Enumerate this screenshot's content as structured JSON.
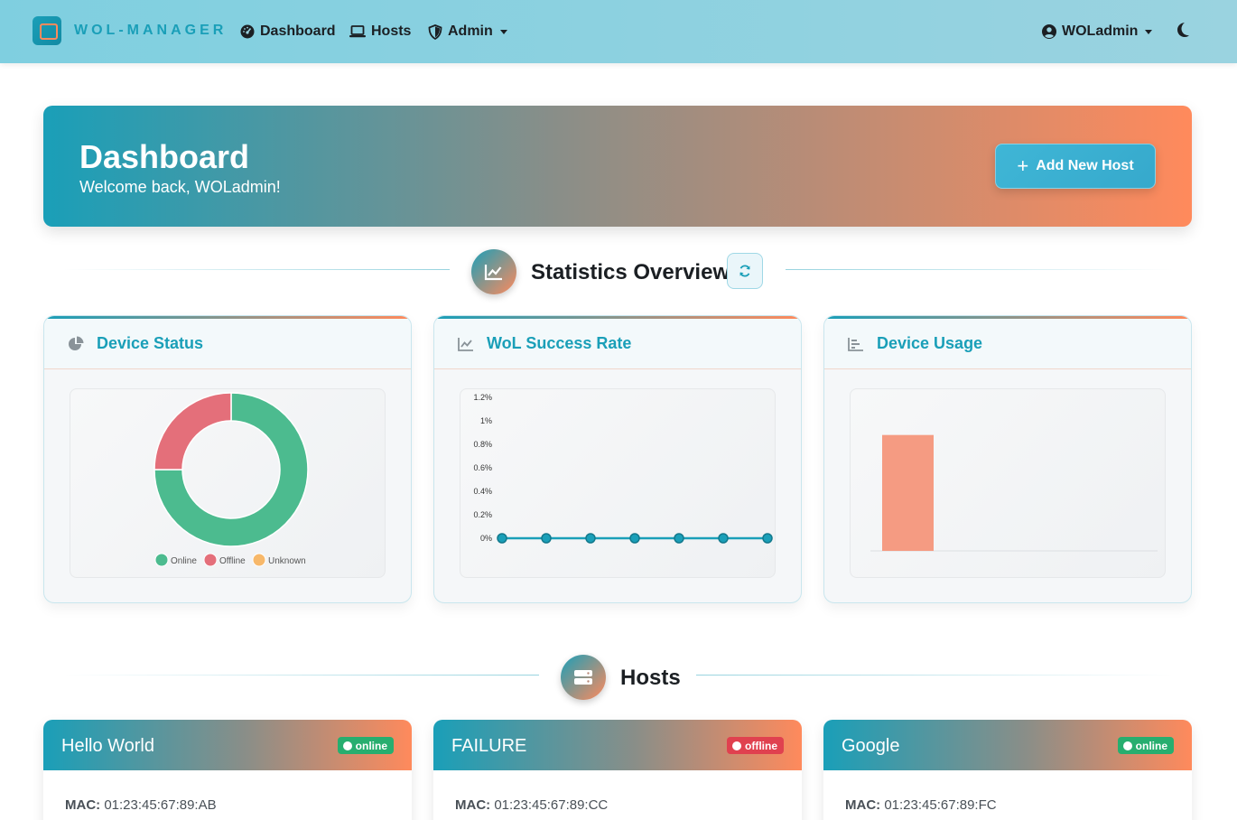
{
  "nav": {
    "brand": "WOL-MANAGER",
    "items": [
      {
        "label": "Dashboard",
        "icon": "gauge-icon"
      },
      {
        "label": "Hosts",
        "icon": "laptop-icon"
      },
      {
        "label": "Admin",
        "icon": "shield-icon"
      }
    ],
    "user": "WOLadmin"
  },
  "banner": {
    "title": "Dashboard",
    "subtitle": "Welcome back, WOLadmin!",
    "add_label": "Add New Host"
  },
  "stats": {
    "title": "Statistics Overview",
    "cards": [
      {
        "title": "Device Status"
      },
      {
        "title": "WoL Success Rate"
      },
      {
        "title": "Device Usage"
      }
    ]
  },
  "hosts_section": {
    "title": "Hosts",
    "mac_label": "MAC:",
    "items": [
      {
        "name": "Hello World",
        "status": "online",
        "mac": "01:23:45:67:89:AB"
      },
      {
        "name": "FAILURE",
        "status": "offline",
        "mac": "01:23:45:67:89:CC"
      },
      {
        "name": "Google",
        "status": "online",
        "mac": "01:23:45:67:89:FC"
      }
    ]
  },
  "colors": {
    "primary": "#1a9fb8",
    "accent": "#ff8a5c",
    "online": "#4cbb8f",
    "offline": "#e46f7a",
    "unknown": "#f7b86a"
  },
  "chart_data": [
    {
      "type": "pie",
      "categories": [
        "Online",
        "Offline",
        "Unknown"
      ],
      "values": [
        3,
        1,
        0
      ],
      "legend": "bottom"
    },
    {
      "type": "line",
      "values": [
        0,
        0,
        0,
        0,
        0,
        0,
        0
      ],
      "y_ticks": [
        "0%",
        "0.2%",
        "0.4%",
        "0.6%",
        "0.8%",
        "1%",
        "1.2%"
      ],
      "ylim": [
        0,
        1.2
      ]
    },
    {
      "type": "bar",
      "values": [
        1,
        0,
        0,
        0
      ],
      "ylim": [
        0,
        1.2
      ]
    }
  ]
}
